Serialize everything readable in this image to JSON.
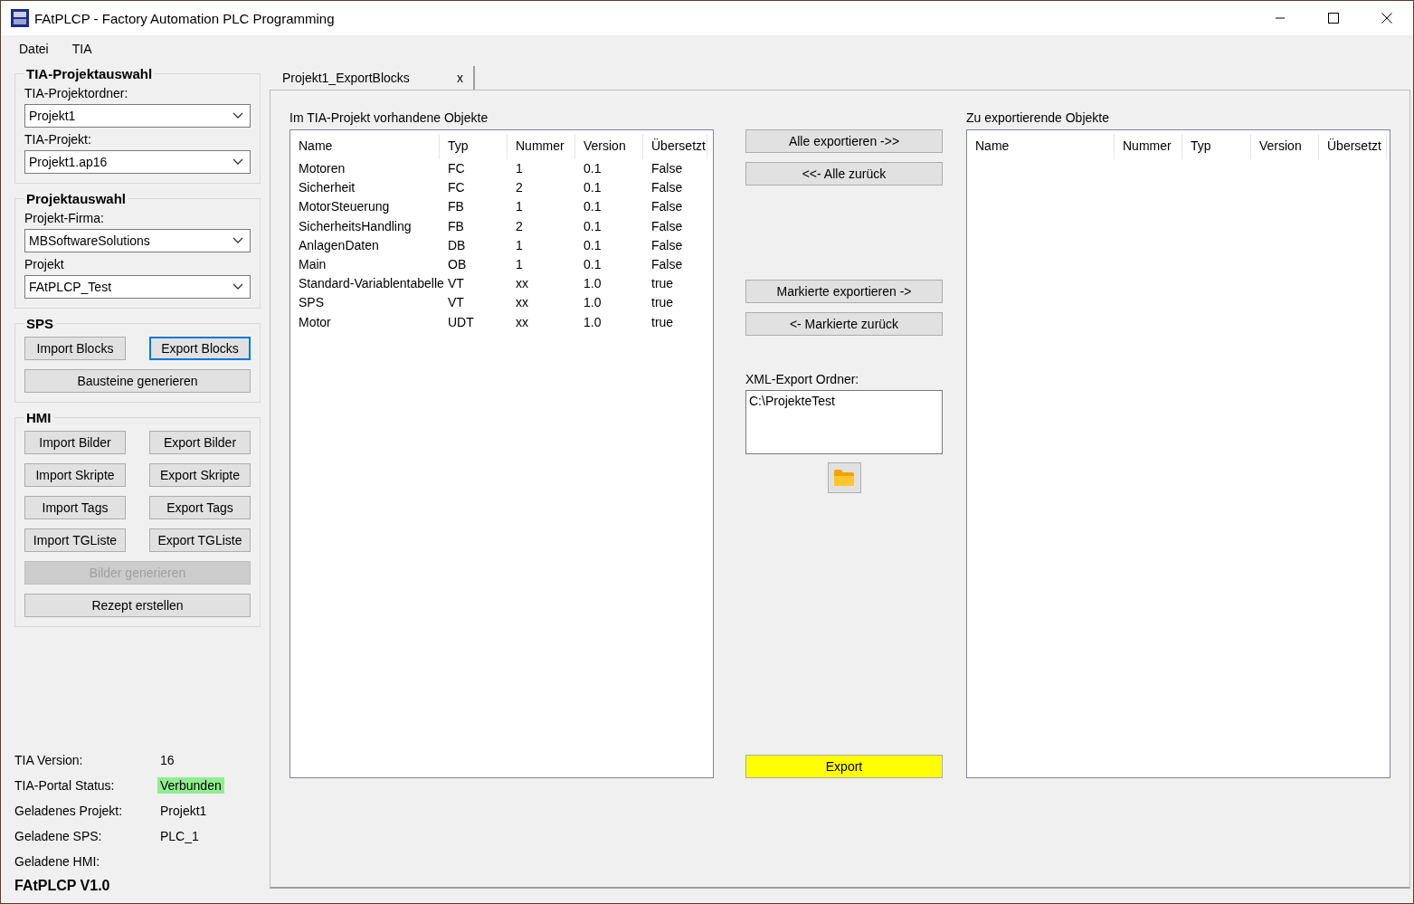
{
  "window": {
    "title": "FAtPLCP - Factory Automation PLC Programming"
  },
  "menu": [
    "Datei",
    "TIA"
  ],
  "sidebar": {
    "groups": [
      {
        "title": "TIA-Projektauswahl",
        "kind": "fields",
        "fields": [
          {
            "label": "TIA-Projektordner:",
            "value": "Projekt1"
          },
          {
            "label": "TIA-Projekt:",
            "value": "Projekt1.ap16"
          }
        ]
      },
      {
        "title": "Projektauswahl",
        "kind": "fields",
        "fields": [
          {
            "label": "Projekt-Firma:",
            "value": "MBSoftwareSolutions"
          },
          {
            "label": "Projekt",
            "value": "FAtPLCP_Test"
          }
        ]
      },
      {
        "title": "SPS",
        "kind": "buttons",
        "buttons": [
          {
            "label": "Import Blocks",
            "kind": "half",
            "focused": false,
            "disabled": false
          },
          {
            "label": "Export Blocks",
            "kind": "half",
            "focused": true,
            "disabled": false
          },
          {
            "label": "Bausteine generieren",
            "kind": "full",
            "focused": false,
            "disabled": false
          }
        ]
      },
      {
        "title": "HMI",
        "kind": "buttons",
        "buttons": [
          {
            "label": "Import Bilder",
            "kind": "half",
            "focused": false,
            "disabled": false
          },
          {
            "label": "Export Bilder",
            "kind": "half",
            "focused": false,
            "disabled": false
          },
          {
            "label": "Import Skripte",
            "kind": "half",
            "focused": false,
            "disabled": false
          },
          {
            "label": "Export Skripte",
            "kind": "half",
            "focused": false,
            "disabled": false
          },
          {
            "label": "Import Tags",
            "kind": "half",
            "focused": false,
            "disabled": false
          },
          {
            "label": "Export Tags",
            "kind": "half",
            "focused": false,
            "disabled": false
          },
          {
            "label": "Import TGListe",
            "kind": "half",
            "focused": false,
            "disabled": false
          },
          {
            "label": "Export TGListe",
            "kind": "half",
            "focused": false,
            "disabled": false
          },
          {
            "label": "Bilder generieren",
            "kind": "full",
            "focused": false,
            "disabled": true
          },
          {
            "label": "Rezept erstellen",
            "kind": "full",
            "focused": false,
            "disabled": false
          }
        ]
      }
    ],
    "status": [
      {
        "label": "TIA Version:",
        "value": "16"
      },
      {
        "label": "TIA-Portal Status:",
        "value": "Verbunden",
        "highlighted": true
      },
      {
        "label": "Geladenes Projekt:",
        "value": "Projekt1"
      },
      {
        "label": "Geladene SPS:",
        "value": "PLC_1"
      },
      {
        "label": "Geladene HMI:"
      }
    ],
    "version": "FAtPLCP V1.0"
  },
  "tabs": [
    {
      "label": "Projekt1_ExportBlocks",
      "close": "x",
      "selected": true
    }
  ],
  "available_list": {
    "title": "Im TIA-Projekt vorhandene Objekte",
    "columns": [
      "Name",
      "Typ",
      "Nummer",
      "Version",
      "Übersetzt"
    ],
    "rows": [
      [
        "Motoren",
        "FC",
        "1",
        "0.1",
        "False"
      ],
      [
        "Sicherheit",
        "FC",
        "2",
        "0.1",
        "False"
      ],
      [
        "MotorSteuerung",
        "FB",
        "1",
        "0.1",
        "False"
      ],
      [
        "SicherheitsHandling",
        "FB",
        "2",
        "0.1",
        "False"
      ],
      [
        "AnlagenDaten",
        "DB",
        "1",
        "0.1",
        "False"
      ],
      [
        "Main",
        "OB",
        "1",
        "0.1",
        "False"
      ],
      [
        "Standard-Variablentabelle",
        "VT",
        "xx",
        "1.0",
        "true"
      ],
      [
        "SPS",
        "VT",
        "xx",
        "1.0",
        "true"
      ],
      [
        "Motor",
        "UDT",
        "xx",
        "1.0",
        "true"
      ]
    ]
  },
  "transfer_buttons": [
    [
      "Alle exportieren ->>",
      "<<- Alle zurück"
    ],
    [
      "Markierte exportieren ->",
      "<- Markierte zurück"
    ]
  ],
  "export_folder": {
    "label": "XML-Export Ordner:",
    "value": "C:\\ProjekteTest"
  },
  "export_button": {
    "label": "Export"
  },
  "export_list": {
    "title": "Zu exportierende Objekte",
    "columns": [
      "Name",
      "Nummer",
      "Typ",
      "Version",
      "Übersetzt"
    ]
  }
}
